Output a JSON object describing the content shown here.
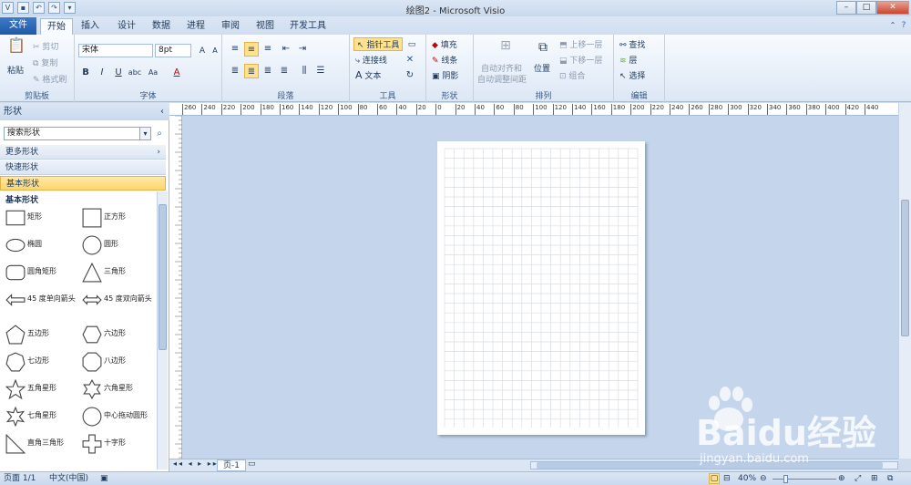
{
  "window": {
    "title": "绘图2 - Microsoft Visio"
  },
  "tabs": [
    "文件",
    "开始",
    "插入",
    "设计",
    "数据",
    "进程",
    "审阅",
    "视图",
    "开发工具"
  ],
  "clipboard": {
    "paste": "粘贴",
    "cut": "剪切",
    "copy": "复制",
    "format_painter": "格式刷",
    "label": "剪贴板"
  },
  "font": {
    "name": "宋体",
    "size": "8pt",
    "label": "字体"
  },
  "paragraph": {
    "label": "段落"
  },
  "tools": {
    "pointer": "指针工具",
    "connector": "连接线",
    "text": "文本",
    "label": "工具"
  },
  "shape_group": {
    "fill": "填充",
    "line": "线条",
    "shadow": "阴影",
    "label": "形状"
  },
  "arrange": {
    "auto_align": "自动对齐和",
    "auto_align2": "自动调整间距",
    "position": "位置",
    "bring_forward": "上移一层",
    "send_backward": "下移一层",
    "group": "组合",
    "label": "排列"
  },
  "editing": {
    "find": "查找",
    "layers": "层",
    "select": "选择",
    "label": "编辑"
  },
  "shapes_panel": {
    "title": "形状",
    "search_placeholder": "搜索形状",
    "more_shapes": "更多形状",
    "quick_shapes": "快速形状",
    "basic_shapes": "基本形状",
    "stencil_title": "基本形状",
    "items": [
      "矩形",
      "正方形",
      "椭圆",
      "圆形",
      "圆角矩形",
      "三角形",
      "45 度单向箭头",
      "45 度双向箭头",
      "五边形",
      "六边形",
      "七边形",
      "八边形",
      "五角星形",
      "六角星形",
      "七角星形",
      "中心拖动圆形",
      "直角三角形",
      "十字形"
    ]
  },
  "ruler_ticks": [
    "260",
    "240",
    "220",
    "200",
    "180",
    "160",
    "140",
    "120",
    "100",
    "80",
    "60",
    "40",
    "20",
    "0",
    "20",
    "40",
    "60",
    "80",
    "100",
    "120",
    "140",
    "160",
    "180",
    "200",
    "220",
    "240",
    "260",
    "280",
    "300",
    "320",
    "340",
    "360",
    "380",
    "400",
    "420",
    "440"
  ],
  "page_tab": "页-1",
  "status": {
    "page": "页面 1/1",
    "language": "中文(中国)",
    "zoom": "40%"
  },
  "watermark": {
    "text": "Baidu经验",
    "url": "jingyan.baidu.com"
  }
}
